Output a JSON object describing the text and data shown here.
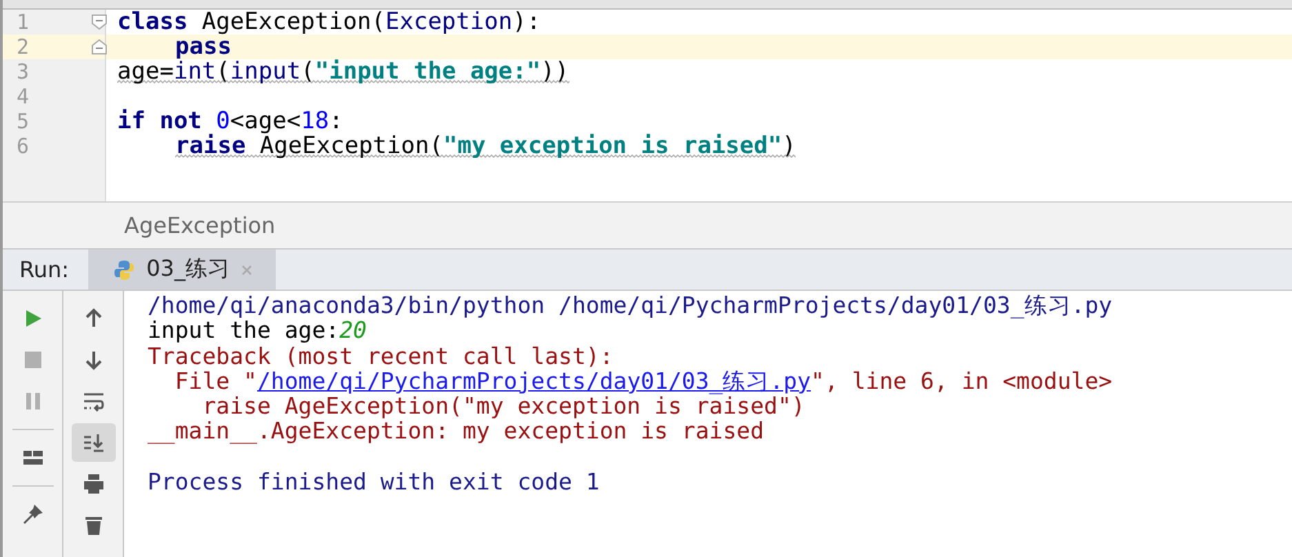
{
  "editor": {
    "lines": [
      {
        "number": "1",
        "fold_start": true,
        "fold_end": false,
        "current": false,
        "indented": false,
        "warning": false,
        "tokens": [
          {
            "kind": "kw",
            "text": "class"
          },
          {
            "kind": "plain",
            "text": " AgeException("
          },
          {
            "kind": "builtin",
            "text": "Exception"
          },
          {
            "kind": "plain",
            "text": "):"
          }
        ]
      },
      {
        "number": "2",
        "fold_start": false,
        "fold_end": true,
        "current": true,
        "indented": true,
        "warning": false,
        "tokens": [
          {
            "kind": "kw",
            "text": "pass"
          }
        ]
      },
      {
        "number": "3",
        "fold_start": false,
        "fold_end": false,
        "current": false,
        "indented": false,
        "warning": true,
        "tokens": [
          {
            "kind": "plain",
            "text": "age="
          },
          {
            "kind": "builtin",
            "text": "int"
          },
          {
            "kind": "plain",
            "text": "("
          },
          {
            "kind": "builtin",
            "text": "input"
          },
          {
            "kind": "plain",
            "text": "("
          },
          {
            "kind": "str",
            "text": "\"input the age:\""
          },
          {
            "kind": "plain",
            "text": "))"
          }
        ]
      },
      {
        "number": "4",
        "fold_start": false,
        "fold_end": false,
        "current": false
      },
      {
        "number": "5",
        "fold_start": false,
        "fold_end": false,
        "current": false,
        "indented": false,
        "warning": false,
        "tokens": [
          {
            "kind": "kw",
            "text": "if not "
          },
          {
            "kind": "num",
            "text": "0"
          },
          {
            "kind": "plain",
            "text": "<age<"
          },
          {
            "kind": "num",
            "text": "18"
          },
          {
            "kind": "plain",
            "text": ":"
          }
        ]
      },
      {
        "number": "6",
        "fold_start": false,
        "fold_end": false,
        "current": false,
        "indented": true,
        "warning": true,
        "tokens": [
          {
            "kind": "kw",
            "text": "raise"
          },
          {
            "kind": "plain",
            "text": " AgeException("
          },
          {
            "kind": "str",
            "text": "\"my exception is raised\""
          },
          {
            "kind": "plain",
            "text": ")"
          }
        ]
      }
    ]
  },
  "breadcrumb": "AgeException",
  "run_panel": {
    "label": "Run:",
    "tabs": [
      {
        "label": "03_练习",
        "selected": true
      }
    ],
    "toolbar_left": [
      {
        "kind": "run",
        "disabled": false
      },
      {
        "kind": "stop",
        "disabled": true
      },
      {
        "kind": "pause",
        "disabled": true
      },
      {
        "kind": "layout",
        "disabled": false
      },
      {
        "kind": "pin",
        "disabled": false
      }
    ],
    "toolbar_right": [
      {
        "kind": "up",
        "on": false
      },
      {
        "kind": "down",
        "on": false
      },
      {
        "kind": "wrap",
        "on": false
      },
      {
        "kind": "scroll-end",
        "on": true
      },
      {
        "kind": "print",
        "on": false
      },
      {
        "kind": "trash",
        "on": false
      }
    ],
    "console": [
      {
        "gap_before": false,
        "tokens": [
          {
            "kind": "sys",
            "text": "/home/qi/anaconda3/bin/python /home/qi/PycharmProjects/day01/03_练习.py"
          }
        ]
      },
      {
        "gap_before": false,
        "tokens": [
          {
            "kind": "plain",
            "text": "input the age:"
          },
          {
            "kind": "input",
            "text": "20"
          }
        ]
      },
      {
        "gap_before": false,
        "tokens": [
          {
            "kind": "err",
            "text": "Traceback (most recent call last):"
          }
        ]
      },
      {
        "gap_before": false,
        "tokens": [
          {
            "kind": "err",
            "text": "  File \""
          },
          {
            "kind": "link",
            "text": "/home/qi/PycharmProjects/day01/03_练习.py"
          },
          {
            "kind": "err",
            "text": "\", line 6, in <module>"
          }
        ]
      },
      {
        "gap_before": false,
        "tokens": [
          {
            "kind": "err",
            "text": "    raise AgeException(\"my exception is raised\")"
          }
        ]
      },
      {
        "gap_before": false,
        "tokens": [
          {
            "kind": "err",
            "text": "__main__.AgeException: my exception is raised"
          }
        ]
      },
      {
        "gap_before": true,
        "tokens": [
          {
            "kind": "sys",
            "text": "Process finished with exit code 1"
          }
        ]
      }
    ]
  }
}
